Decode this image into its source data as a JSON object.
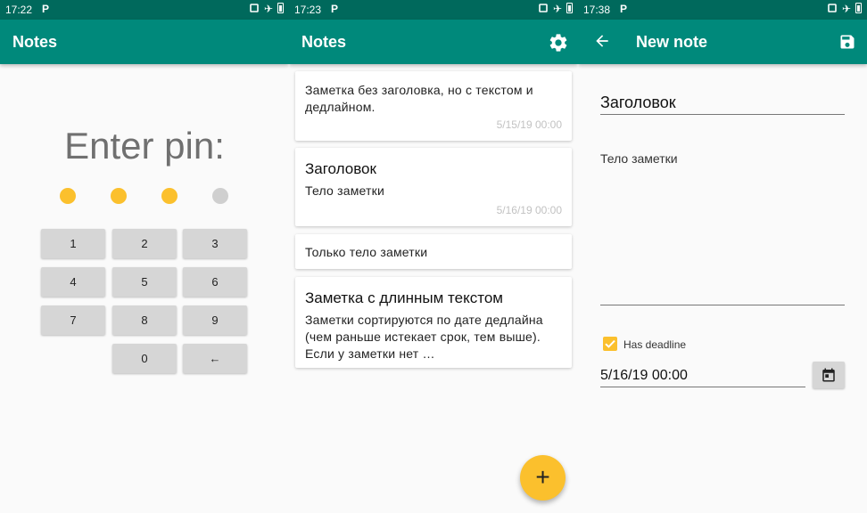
{
  "screens": [
    {
      "status_time": "17:22",
      "app_title": "Notes",
      "pin_title": "Enter pin:",
      "pin_dots": [
        "filled",
        "filled",
        "filled",
        "empty"
      ],
      "keys": [
        "1",
        "2",
        "3",
        "4",
        "5",
        "6",
        "7",
        "8",
        "9",
        "0",
        "←"
      ]
    },
    {
      "status_time": "17:23",
      "app_title": "Notes",
      "settings_icon": "gear-icon",
      "notes": [
        {
          "title": "",
          "body": "Заметка без заголовка, но с текстом и дедлайном.",
          "date": "5/15/19 00:00"
        },
        {
          "title": "Заголовок",
          "body": "Тело заметки",
          "date": "5/16/19 00:00"
        },
        {
          "title": "",
          "body": "Только тело заметки",
          "date": ""
        },
        {
          "title": "Заметка с длинным текстом",
          "body": "Заметки сортируются по дате дедлайна (чем раньше истекает срок, тем выше). Если у заметки нет …",
          "date": ""
        }
      ],
      "fab_label": "+"
    },
    {
      "status_time": "17:38",
      "app_title": "New note",
      "note_title": "Заголовок",
      "note_body": "Тело заметки",
      "deadline_label": "Has deadline",
      "deadline_checked": true,
      "deadline_value": "5/16/19 00:00"
    }
  ],
  "status_p": "P",
  "colors": {
    "status_bar": "#00695c",
    "app_bar": "#00897b",
    "accent": "#fbc02d",
    "dot_empty": "#cfcfcf",
    "key_bg": "#d6d6d6"
  }
}
